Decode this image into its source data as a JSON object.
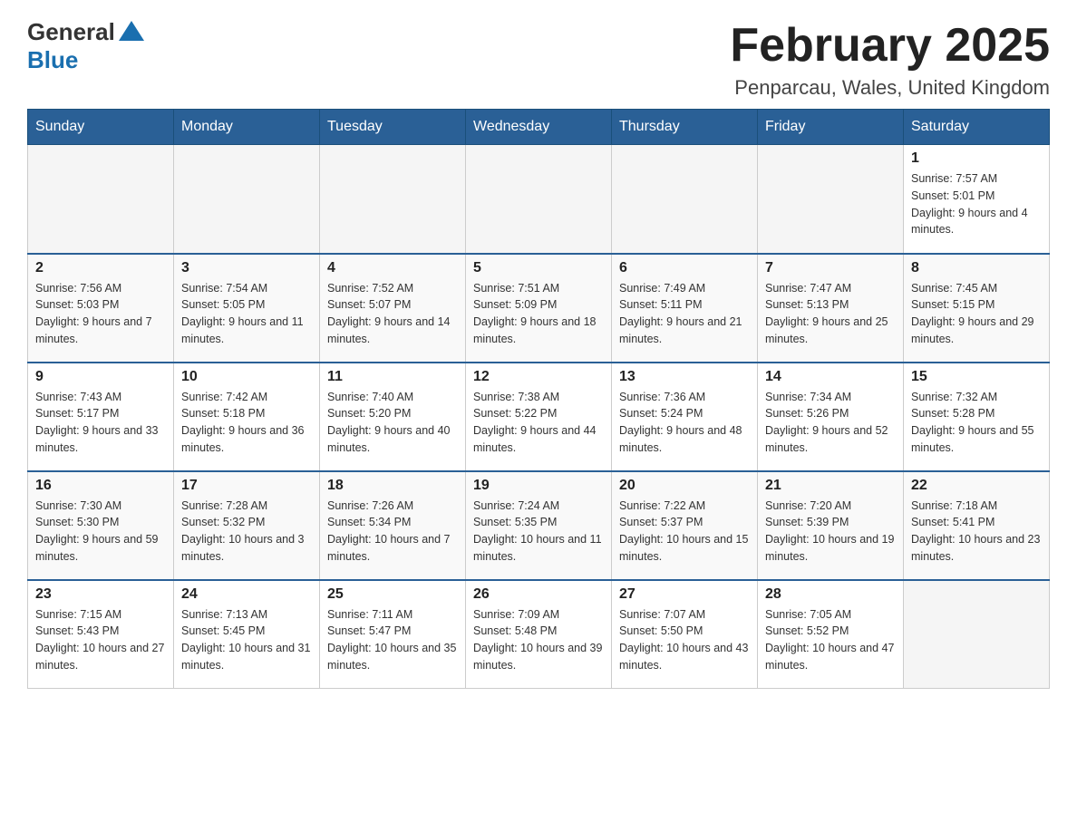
{
  "header": {
    "logo_general": "General",
    "logo_blue": "Blue",
    "title": "February 2025",
    "location": "Penparcau, Wales, United Kingdom"
  },
  "weekdays": [
    "Sunday",
    "Monday",
    "Tuesday",
    "Wednesday",
    "Thursday",
    "Friday",
    "Saturday"
  ],
  "weeks": [
    [
      {
        "day": "",
        "info": ""
      },
      {
        "day": "",
        "info": ""
      },
      {
        "day": "",
        "info": ""
      },
      {
        "day": "",
        "info": ""
      },
      {
        "day": "",
        "info": ""
      },
      {
        "day": "",
        "info": ""
      },
      {
        "day": "1",
        "info": "Sunrise: 7:57 AM\nSunset: 5:01 PM\nDaylight: 9 hours and 4 minutes."
      }
    ],
    [
      {
        "day": "2",
        "info": "Sunrise: 7:56 AM\nSunset: 5:03 PM\nDaylight: 9 hours and 7 minutes."
      },
      {
        "day": "3",
        "info": "Sunrise: 7:54 AM\nSunset: 5:05 PM\nDaylight: 9 hours and 11 minutes."
      },
      {
        "day": "4",
        "info": "Sunrise: 7:52 AM\nSunset: 5:07 PM\nDaylight: 9 hours and 14 minutes."
      },
      {
        "day": "5",
        "info": "Sunrise: 7:51 AM\nSunset: 5:09 PM\nDaylight: 9 hours and 18 minutes."
      },
      {
        "day": "6",
        "info": "Sunrise: 7:49 AM\nSunset: 5:11 PM\nDaylight: 9 hours and 21 minutes."
      },
      {
        "day": "7",
        "info": "Sunrise: 7:47 AM\nSunset: 5:13 PM\nDaylight: 9 hours and 25 minutes."
      },
      {
        "day": "8",
        "info": "Sunrise: 7:45 AM\nSunset: 5:15 PM\nDaylight: 9 hours and 29 minutes."
      }
    ],
    [
      {
        "day": "9",
        "info": "Sunrise: 7:43 AM\nSunset: 5:17 PM\nDaylight: 9 hours and 33 minutes."
      },
      {
        "day": "10",
        "info": "Sunrise: 7:42 AM\nSunset: 5:18 PM\nDaylight: 9 hours and 36 minutes."
      },
      {
        "day": "11",
        "info": "Sunrise: 7:40 AM\nSunset: 5:20 PM\nDaylight: 9 hours and 40 minutes."
      },
      {
        "day": "12",
        "info": "Sunrise: 7:38 AM\nSunset: 5:22 PM\nDaylight: 9 hours and 44 minutes."
      },
      {
        "day": "13",
        "info": "Sunrise: 7:36 AM\nSunset: 5:24 PM\nDaylight: 9 hours and 48 minutes."
      },
      {
        "day": "14",
        "info": "Sunrise: 7:34 AM\nSunset: 5:26 PM\nDaylight: 9 hours and 52 minutes."
      },
      {
        "day": "15",
        "info": "Sunrise: 7:32 AM\nSunset: 5:28 PM\nDaylight: 9 hours and 55 minutes."
      }
    ],
    [
      {
        "day": "16",
        "info": "Sunrise: 7:30 AM\nSunset: 5:30 PM\nDaylight: 9 hours and 59 minutes."
      },
      {
        "day": "17",
        "info": "Sunrise: 7:28 AM\nSunset: 5:32 PM\nDaylight: 10 hours and 3 minutes."
      },
      {
        "day": "18",
        "info": "Sunrise: 7:26 AM\nSunset: 5:34 PM\nDaylight: 10 hours and 7 minutes."
      },
      {
        "day": "19",
        "info": "Sunrise: 7:24 AM\nSunset: 5:35 PM\nDaylight: 10 hours and 11 minutes."
      },
      {
        "day": "20",
        "info": "Sunrise: 7:22 AM\nSunset: 5:37 PM\nDaylight: 10 hours and 15 minutes."
      },
      {
        "day": "21",
        "info": "Sunrise: 7:20 AM\nSunset: 5:39 PM\nDaylight: 10 hours and 19 minutes."
      },
      {
        "day": "22",
        "info": "Sunrise: 7:18 AM\nSunset: 5:41 PM\nDaylight: 10 hours and 23 minutes."
      }
    ],
    [
      {
        "day": "23",
        "info": "Sunrise: 7:15 AM\nSunset: 5:43 PM\nDaylight: 10 hours and 27 minutes."
      },
      {
        "day": "24",
        "info": "Sunrise: 7:13 AM\nSunset: 5:45 PM\nDaylight: 10 hours and 31 minutes."
      },
      {
        "day": "25",
        "info": "Sunrise: 7:11 AM\nSunset: 5:47 PM\nDaylight: 10 hours and 35 minutes."
      },
      {
        "day": "26",
        "info": "Sunrise: 7:09 AM\nSunset: 5:48 PM\nDaylight: 10 hours and 39 minutes."
      },
      {
        "day": "27",
        "info": "Sunrise: 7:07 AM\nSunset: 5:50 PM\nDaylight: 10 hours and 43 minutes."
      },
      {
        "day": "28",
        "info": "Sunrise: 7:05 AM\nSunset: 5:52 PM\nDaylight: 10 hours and 47 minutes."
      },
      {
        "day": "",
        "info": ""
      }
    ]
  ]
}
